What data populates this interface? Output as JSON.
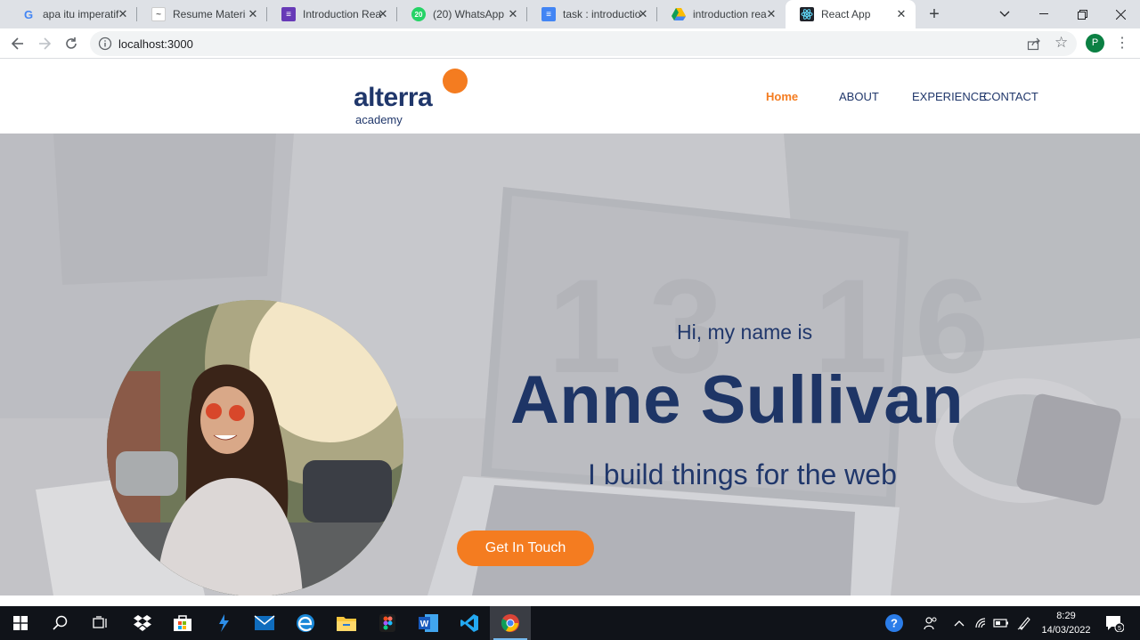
{
  "browser": {
    "tabs": [
      {
        "title": "apa itu imperatif",
        "favicon": "google-g-icon"
      },
      {
        "title": "Resume Materi",
        "favicon": "notion-doc-icon"
      },
      {
        "title": "Introduction Rea",
        "favicon": "forms-list-icon"
      },
      {
        "title": "(20) WhatsApp",
        "favicon": "whatsapp-icon",
        "badge": "20"
      },
      {
        "title": "task : introductio",
        "favicon": "google-docs-icon"
      },
      {
        "title": "introduction rea",
        "favicon": "google-drive-icon"
      },
      {
        "title": "React App",
        "favicon": "react-icon",
        "active": true
      }
    ],
    "url": "localhost:3000",
    "profile_initial": "P"
  },
  "site": {
    "logo": {
      "word": "alterra",
      "sub": "academy",
      "accent": "#f47c20",
      "brand": "#20376b"
    },
    "nav": [
      {
        "label": "Home",
        "active": true
      },
      {
        "label": "ABOUT"
      },
      {
        "label": "EXPERIENCE"
      },
      {
        "label": "CONTACT"
      }
    ],
    "hero": {
      "greeting": "Hi, my name is",
      "name": "Anne Sullivan",
      "tagline": "I build things for the web",
      "cta": "Get In Touch",
      "bg_numbers": "13 16"
    }
  },
  "taskbar": {
    "apps": [
      "windows-start-icon",
      "search-icon",
      "task-view-icon",
      "dropbox-icon",
      "store-icon",
      "azure-data-studio-icon",
      "mail-icon",
      "edge-icon",
      "file-explorer-icon",
      "figma-icon",
      "word-icon",
      "vscode-icon",
      "chrome-icon"
    ],
    "time": "8:29",
    "date": "14/03/2022",
    "notification_count": "5"
  }
}
